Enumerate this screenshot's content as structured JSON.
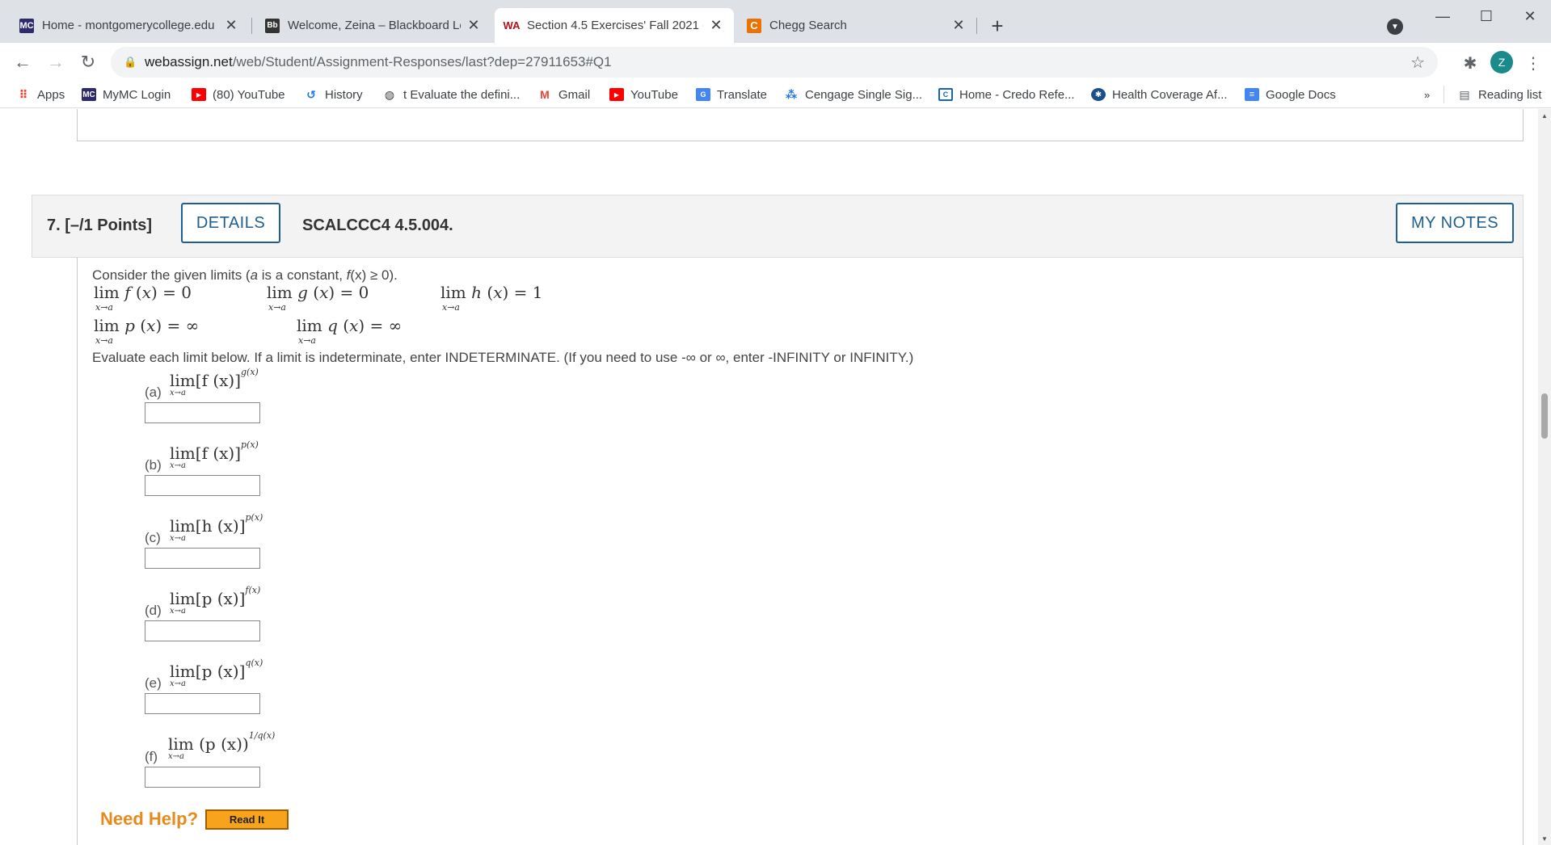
{
  "browser": {
    "tabs": [
      {
        "favicon": "MC",
        "title": "Home - montgomerycollege.edu"
      },
      {
        "favicon": "Bb",
        "title": "Welcome, Zeina – Blackboard Lea"
      },
      {
        "favicon": "WA",
        "title": "Section 4.5 Exercises' Fall 2021 -"
      },
      {
        "favicon": "C",
        "title": "Chegg Search"
      }
    ],
    "new_tab": "+",
    "url_host": "webassign.net",
    "url_path": "/web/Student/Assignment-Responses/last?dep=27911653#Q1",
    "profile_initial": "Z",
    "bookmarks": [
      {
        "icon": "apps-icon",
        "label": "Apps"
      },
      {
        "icon": "MC",
        "label": "MyMC Login"
      },
      {
        "icon": "youtube-icon",
        "label": "(80) YouTube"
      },
      {
        "icon": "history-icon",
        "label": "History"
      },
      {
        "icon": "globe-icon",
        "label": "t Evaluate the defini..."
      },
      {
        "icon": "gmail-icon",
        "label": "Gmail"
      },
      {
        "icon": "youtube-icon",
        "label": "YouTube"
      },
      {
        "icon": "translate-icon",
        "label": "Translate"
      },
      {
        "icon": "cengage-icon",
        "label": "Cengage Single Sig..."
      },
      {
        "icon": "credo-icon",
        "label": "Home - Credo Refe..."
      },
      {
        "icon": "health-icon",
        "label": "Health Coverage Af..."
      },
      {
        "icon": "docs-icon",
        "label": "Google Docs"
      }
    ],
    "more": "»",
    "reading_list": "Reading list"
  },
  "question": {
    "number_points": "7.  [–/1 Points]",
    "details_label": "DETAILS",
    "code": "SCALCCC4 4.5.004.",
    "notes_label": "MY NOTES",
    "intro_prefix": "Consider the given limits (",
    "intro_a": "a",
    "intro_mid": " is a constant, ",
    "intro_fx": "f",
    "intro_suffix": "(x) ≥ 0).",
    "given": [
      {
        "fn": "f",
        "val": "0"
      },
      {
        "fn": "g",
        "val": "0"
      },
      {
        "fn": "h",
        "val": "1"
      },
      {
        "fn": "p",
        "val": "∞"
      },
      {
        "fn": "q",
        "val": "∞"
      }
    ],
    "lim": "lim",
    "lim_sub": "x→a",
    "instructions": "Evaluate each limit below. If a limit is indeterminate, enter INDETERMINATE. (If you need to use -∞ or ∞, enter -INFINITY or INFINITY.)",
    "parts": [
      {
        "label": "(a)",
        "base": "[f (x)]",
        "exp": "g(x)",
        "answer": ""
      },
      {
        "label": "(b)",
        "base": "[f (x)]",
        "exp": "p(x)",
        "answer": ""
      },
      {
        "label": "(c)",
        "base": "[h (x)]",
        "exp": "p(x)",
        "answer": ""
      },
      {
        "label": "(d)",
        "base": "[p (x)]",
        "exp": "f(x)",
        "answer": ""
      },
      {
        "label": "(e)",
        "base": "[p (x)]",
        "exp": "q(x)",
        "answer": ""
      },
      {
        "label": "(f)",
        "base": "(p (x))",
        "exp": "1/q(x)",
        "answer": ""
      }
    ],
    "need_help": "Need Help?",
    "read_it": "Read It"
  },
  "colors": {
    "accent": "#1f5f8f",
    "help": "#e8891b",
    "read_it_bg": "#f7a31c"
  }
}
